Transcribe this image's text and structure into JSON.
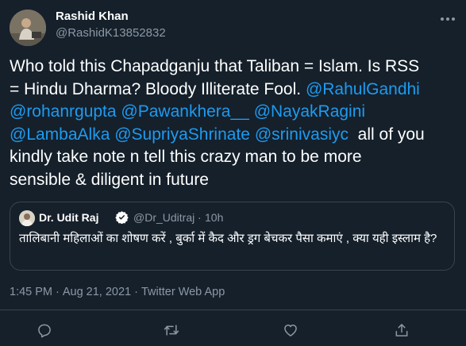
{
  "author": {
    "name": "Rashid Khan",
    "handle": "@RashidK13852832"
  },
  "tweet": {
    "line1": "Who told this Chapadganju that Taliban = Islam. Is RSS",
    "line2": "= Hindu Dharma? Bloody Illiterate Fool. ",
    "mentions": [
      "@RahulGandhi",
      "@rohanrgupta",
      "@Pawankhera__",
      "@NayakRagini",
      "@LambaAlka",
      "@SupriyaShrinate",
      "@srinivasiyc"
    ],
    "line5_rest": "  all of you",
    "line6": "kindly take note n tell this crazy man to be more",
    "line7": "sensible & diligent in future"
  },
  "quote": {
    "name": "Dr. Udit Raj",
    "handle": "@Dr_Uditraj",
    "separator": "·",
    "time": "10h",
    "text": "तालिबानी महिलाओं का  शोषण करें , बुर्का में कैद और ड्रग बेचकर पैसा कमाएं , क्या यही इस्लाम है?"
  },
  "meta": {
    "time": "1:45 PM",
    "separator": "·",
    "date": "Aug 21, 2021",
    "source": "Twitter Web App"
  },
  "icons": {
    "more": "more-horizontal-icon",
    "verified": "verified-badge-icon",
    "reply": "reply-icon",
    "retweet": "retweet-icon",
    "like": "like-icon",
    "share": "share-icon"
  },
  "colors": {
    "background": "#15202b",
    "text": "#ffffff",
    "secondary": "#8b98a5",
    "mention": "#1d9bf0",
    "border": "#38444d"
  }
}
